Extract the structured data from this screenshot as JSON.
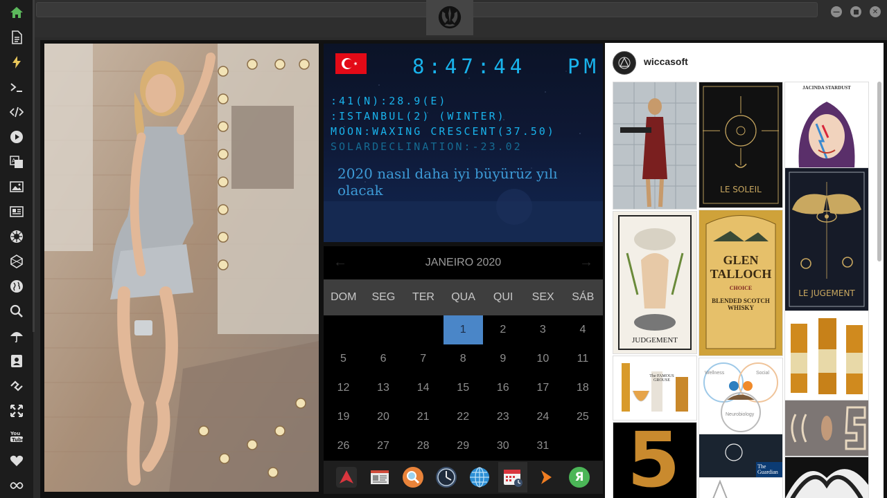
{
  "sidebar": {
    "icons": [
      "home-icon",
      "document-icon",
      "lightning-icon",
      "terminal-icon",
      "code-icon",
      "play-icon",
      "translate-icon",
      "image-icon",
      "news-icon",
      "rebel-icon",
      "hexagon-icon",
      "globe-icon",
      "search-icon",
      "umbrella-icon",
      "contact-icon",
      "link-icon",
      "expand-icon",
      "youtube-icon",
      "heart-icon",
      "infinity-icon"
    ],
    "youtube_label": "You Tube"
  },
  "window": {
    "controls": [
      "minimize",
      "maximize",
      "close"
    ]
  },
  "clock": {
    "time": "8:47:44",
    "ampm": "PM",
    "coords": ":41(N):28.9(E)",
    "location": ":ISTANBUL(2) (WINTER)",
    "moon": "MOON:WAXING CRESCENT(37.50)",
    "solar": "SOLARDECLINATION:-23.02",
    "message": "2020 nasıl daha iyi büyürüz yılı olacak",
    "flag": "Turkey"
  },
  "calendar": {
    "month_label": "JANEIRO 2020",
    "prev_label": "←",
    "next_label": "→",
    "weekdays": [
      "DOM",
      "SEG",
      "TER",
      "QUA",
      "QUI",
      "SEX",
      "SÁB"
    ],
    "first_weekday_index": 3,
    "days_in_month": 31,
    "today": 1
  },
  "dock": {
    "apps": [
      "launcher",
      "news-reader",
      "search",
      "clock",
      "globe",
      "calendar",
      "forward",
      "yandex"
    ],
    "yandex_label": "Я"
  },
  "instagram": {
    "username": "wiccasoft",
    "tiles": {
      "jacinda": "JACINDA STARDUST",
      "soleil": "LE SOLEIL",
      "judgement_card": "JUDGEMENT",
      "le_judgement": "LE JUGEMENT",
      "glen": "GLEN TALLOCH",
      "glen_sub": "CHOICE",
      "glen_desc": "BLENDED SCOTCH WHISKY",
      "grouse": "The FAMOUS GROUSE",
      "wellness": "Wellness",
      "social": "Social",
      "neuro": "Neurobiology",
      "guardian": "The Guardian",
      "five": "5"
    }
  }
}
